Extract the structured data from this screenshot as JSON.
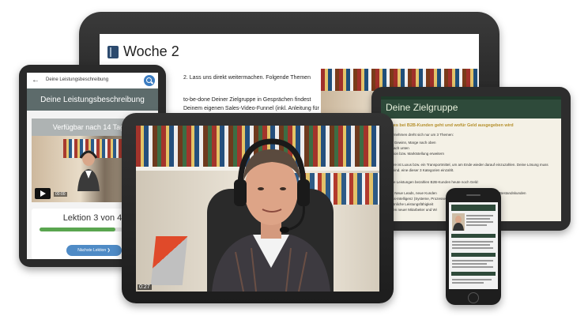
{
  "week_page": {
    "title": "Woche 2",
    "text_lines": [
      "2. Lass uns direkt weitermachen. Folgende Themen",
      "to-be-done Deiner Zielgruppe in Gesprächen findest",
      "Deinem eigenen Sales-Video-Funnel (inkl. Anleitung für"
    ]
  },
  "course_mobile": {
    "topbar_title": "Deine Leistungsbeschreibung",
    "header": "Deine Leistungsbeschreibung",
    "locked_label": "Verfügbar nach 14 Tagen",
    "video_time": "00:00",
    "lesson_title": "Lektion 3 von 4",
    "progress": 0.72,
    "next_button": "Nächste Lektion"
  },
  "target_page": {
    "title": "Deine Zielgruppe",
    "subtitle": "um es bei B2B-Kunden geht und wofür Geld ausgegeben wird",
    "lines": [
      "Unternehmen dreht sich nur um 3 Themen:",
      "satz, Gewinn, Marge nach oben",
      "ten nach unten",
      "putation bzw. Marktstellung erweitern",
      "andere ist Luxus bzw. ein Transportmittel, um am Ende wieder darauf einzuzahlen. Deine Lösung muss",
      "auf mind. eine dieser 3 Kategorien einzahlt.",
      "gende Leistungen bezahlen B2B-Kunden heute noch Geld:",
      "treib: Neue Leads, neue Kunden",
      "siness-Intelligenz (Systeme, Prozesse",
      "persönliche Leistungsfähigkeit",
      "winnen neuer Mitarbeiter und Wi"
    ],
    "extra_text": "Bestandskunden"
  },
  "video_main": {
    "timecode": "0:27"
  },
  "colors": {
    "green_header": "#2e4a3a",
    "accent_blue": "#4f8bc6",
    "progress_green": "#5aa54f",
    "gold": "#b58f2a"
  }
}
